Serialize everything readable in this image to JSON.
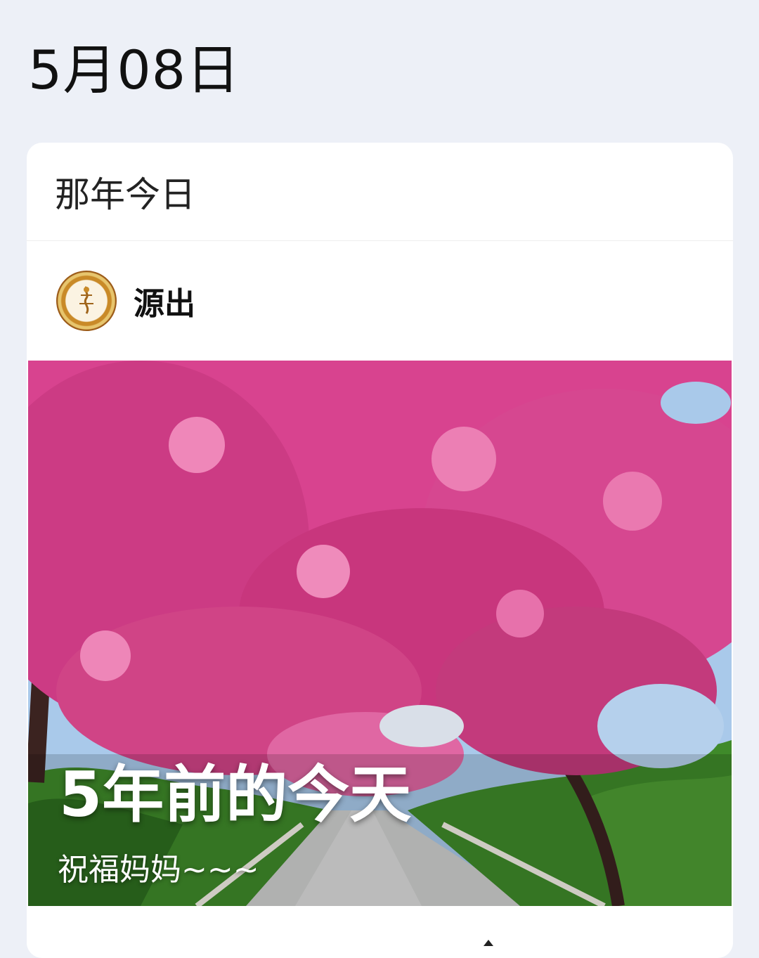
{
  "header": {
    "date": "5月08日"
  },
  "card": {
    "title": "那年今日",
    "author": {
      "name": "源出",
      "avatar_icon": "logo-avatar-icon"
    },
    "photo": {
      "overlay_title": "5年前的今天",
      "overlay_subtitle": "祝福妈妈~~~"
    }
  },
  "colors": {
    "background": "#edf0f7",
    "card": "#ffffff",
    "blossom": "#d8438f",
    "foliage": "#3f8a2a"
  }
}
